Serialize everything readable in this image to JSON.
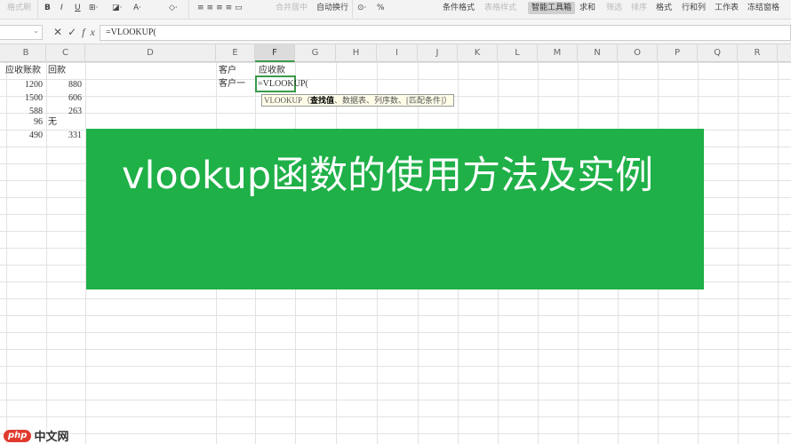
{
  "toolbar": {
    "format_painter": "格式刷",
    "bold": "B",
    "italic": "I",
    "underline": "U",
    "merge_center": "合并居中",
    "wrap_text": "自动换行",
    "percent": "%",
    "conditional_format": "条件格式",
    "table_style": "表格样式",
    "smart_toolbox": "智能工具箱",
    "sum": "求和",
    "filter": "筛选",
    "sort": "排序",
    "format": "格式",
    "row_col": "行和列",
    "worksheet": "工作表",
    "freeze": "冻结窗格"
  },
  "formula_bar": {
    "cancel": "✕",
    "confirm": "✓",
    "fx": "fx",
    "value": "=VLOOKUP("
  },
  "columns": [
    "B",
    "C",
    "D",
    "E",
    "F",
    "G",
    "H",
    "I",
    "J",
    "K",
    "L",
    "M",
    "N",
    "O",
    "P",
    "Q",
    "R"
  ],
  "selected_column": "F",
  "cells": {
    "B1": "应收账款",
    "C1": "回款",
    "B2": "1200",
    "C2": "880",
    "B3": "1500",
    "C3": "606",
    "B4": "588",
    "C4": "263",
    "B5": "96",
    "C5": "无",
    "B6": "490",
    "C6": "331",
    "E1": "客户",
    "F1": "应收款",
    "E2": "客户一",
    "F2": "=VLOOKUP("
  },
  "tooltip": {
    "fn": "VLOOKUP",
    "open": "（",
    "arg1": "查找值",
    "rest": "、数据表、列序数、[匹配条件]）"
  },
  "banner": {
    "title": "vlookup函数的使用方法及实例",
    "color": "#1fb048"
  },
  "watermark": {
    "logo": "php",
    "text": "中文网"
  }
}
